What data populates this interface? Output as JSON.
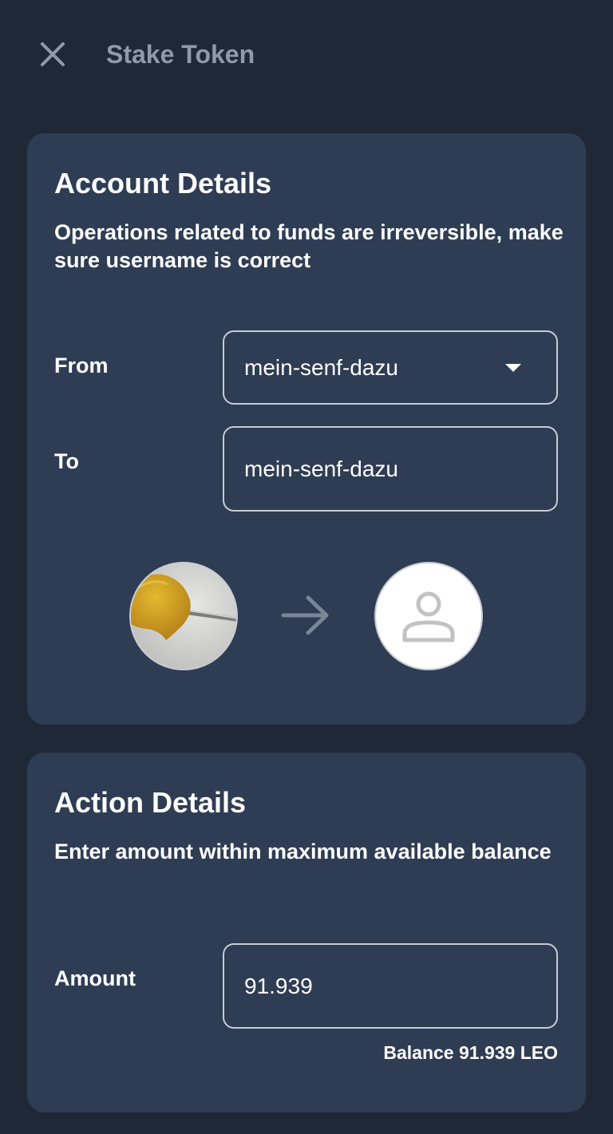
{
  "header": {
    "title": "Stake Token",
    "close_icon": "close-icon"
  },
  "account_details": {
    "title": "Account Details",
    "subtitle": "Operations related to funds are irreversible, make sure username is correct",
    "from": {
      "label": "From",
      "value": "mein-senf-dazu"
    },
    "to": {
      "label": "To",
      "value": "mein-senf-dazu"
    },
    "transfer_icon": "arrow-right-icon",
    "to_avatar_icon": "user-placeholder-icon"
  },
  "action_details": {
    "title": "Action Details",
    "subtitle": "Enter amount within maximum available balance",
    "amount": {
      "label": "Amount",
      "value": "91.939"
    },
    "balance": "Balance 91.939 LEO"
  },
  "colors": {
    "background": "#1f2836",
    "card": "#2e3d54",
    "header_title": "#8f9aa8",
    "border": "#c6ccd4"
  }
}
